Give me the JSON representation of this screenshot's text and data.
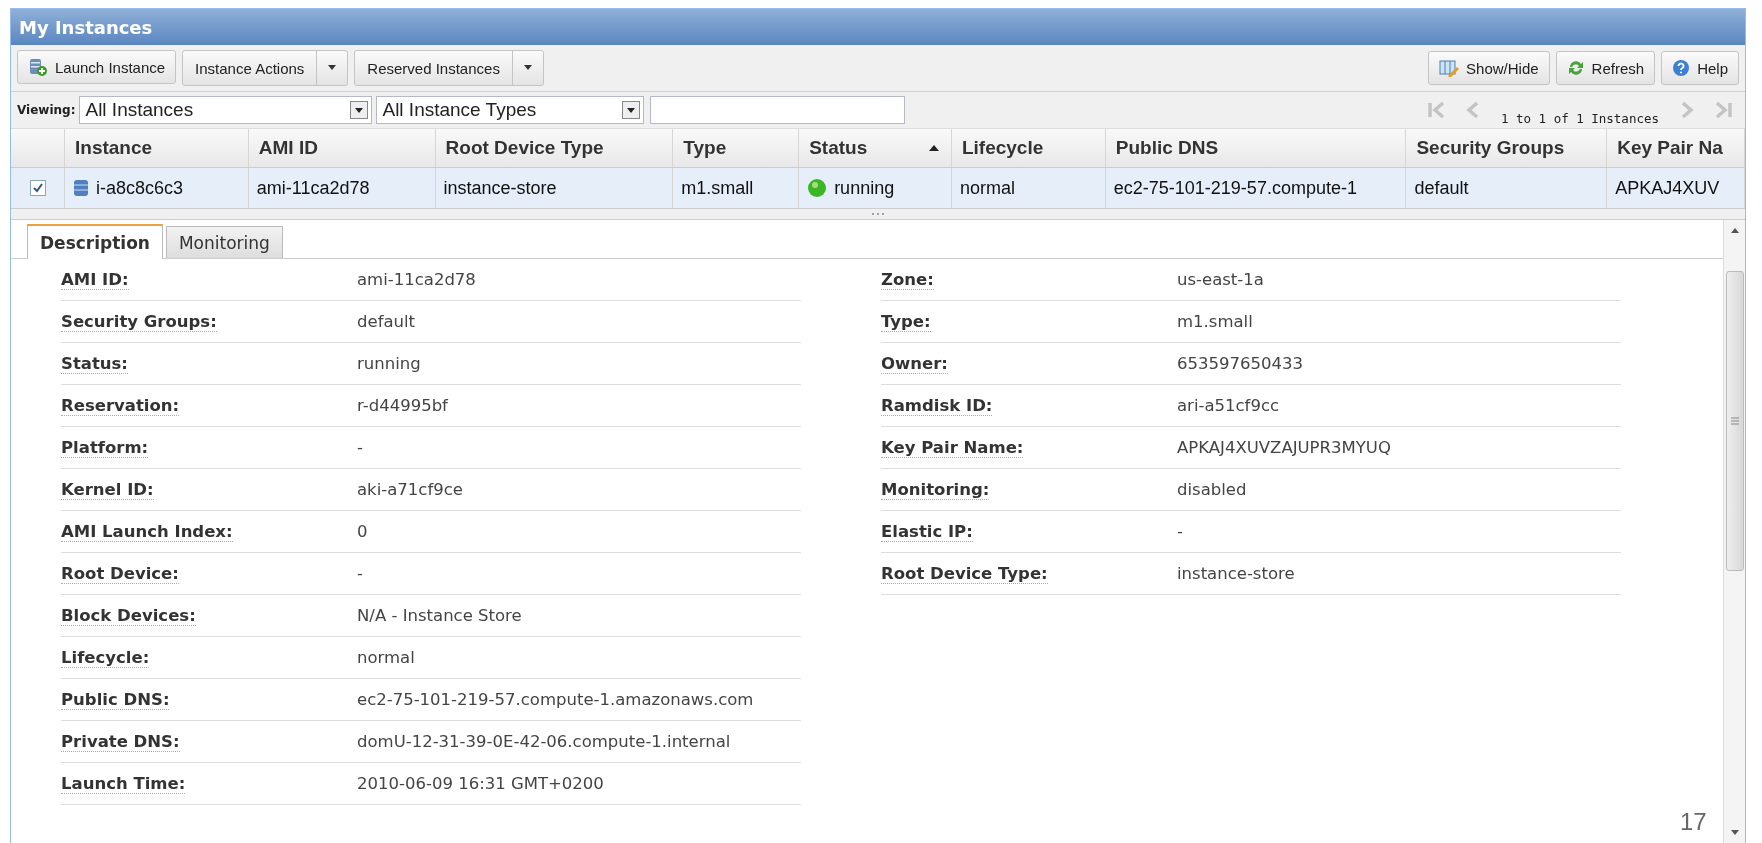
{
  "window": {
    "title": "My Instances"
  },
  "toolbar": {
    "left": [
      {
        "label": "Launch Instance",
        "kind": "icon"
      },
      {
        "label": "Instance Actions",
        "kind": "split"
      },
      {
        "label": "Reserved Instances",
        "kind": "split"
      }
    ],
    "right": [
      {
        "label": "Show/Hide",
        "kind": "showhide"
      },
      {
        "label": "Refresh",
        "kind": "refresh"
      },
      {
        "label": "Help",
        "kind": "help"
      }
    ]
  },
  "filter": {
    "label": "Viewing:",
    "dropdowns": [
      "All Instances",
      "All Instance Types"
    ],
    "pager_text": "1 to 1 of 1 Instances",
    "pager_disabled": true
  },
  "table": {
    "columns": [
      {
        "label": "Instance",
        "sorted": false
      },
      {
        "label": "AMI ID",
        "sorted": false
      },
      {
        "label": "Root Device Type",
        "sorted": false
      },
      {
        "label": "Type",
        "sorted": false
      },
      {
        "label": "Status",
        "sorted": true
      },
      {
        "label": "Lifecycle",
        "sorted": false
      },
      {
        "label": "Public DNS",
        "sorted": false
      },
      {
        "label": "Security Groups",
        "sorted": false
      },
      {
        "label": "Key Pair Na",
        "sorted": false
      }
    ],
    "rows": [
      {
        "selected": true,
        "checked": true,
        "cells": [
          "i-a8c8c6c3",
          "ami-11ca2d78",
          "instance-store",
          "m1.small",
          "running",
          "normal",
          "ec2-75-101-219-57.compute-1",
          "default",
          "APKAJ4XUV"
        ]
      }
    ]
  },
  "tabs": [
    {
      "label": "Description",
      "selected": true
    },
    {
      "label": "Monitoring",
      "selected": false
    }
  ],
  "details_left": [
    {
      "label": "AMI ID:",
      "value": "ami-11ca2d78"
    },
    {
      "label": "Security Groups:",
      "value": "default"
    },
    {
      "label": "Status:",
      "value": "running"
    },
    {
      "label": "Reservation:",
      "value": "r-d44995bf"
    },
    {
      "label": "Platform:",
      "value": "-"
    },
    {
      "label": "Kernel ID:",
      "value": "aki-a71cf9ce"
    },
    {
      "label": "AMI Launch Index:",
      "value": "0"
    },
    {
      "label": "Root Device:",
      "value": "-"
    },
    {
      "label": "Block Devices:",
      "value": "N/A - Instance Store"
    },
    {
      "label": "Lifecycle:",
      "value": "normal"
    },
    {
      "label": "Public DNS:",
      "value": "ec2-75-101-219-57.compute-1.amazonaws.com"
    },
    {
      "label": "Private DNS:",
      "value": "domU-12-31-39-0E-42-06.compute-1.internal"
    },
    {
      "label": "Launch Time:",
      "value": "2010-06-09 16:31 GMT+0200"
    }
  ],
  "details_right": [
    {
      "label": "Zone:",
      "value": "us-east-1a"
    },
    {
      "label": "Type:",
      "value": "m1.small"
    },
    {
      "label": "Owner:",
      "value": "653597650433"
    },
    {
      "label": "Ramdisk ID:",
      "value": "ari-a51cf9cc"
    },
    {
      "label": "Key Pair Name:",
      "value": "APKAJ4XUVZAJUPR3MYUQ"
    },
    {
      "label": "Monitoring:",
      "value": "disabled"
    },
    {
      "label": "Elastic IP:",
      "value": "-"
    },
    {
      "label": "Root Device Type:",
      "value": "instance-store"
    }
  ],
  "page_number": "17"
}
